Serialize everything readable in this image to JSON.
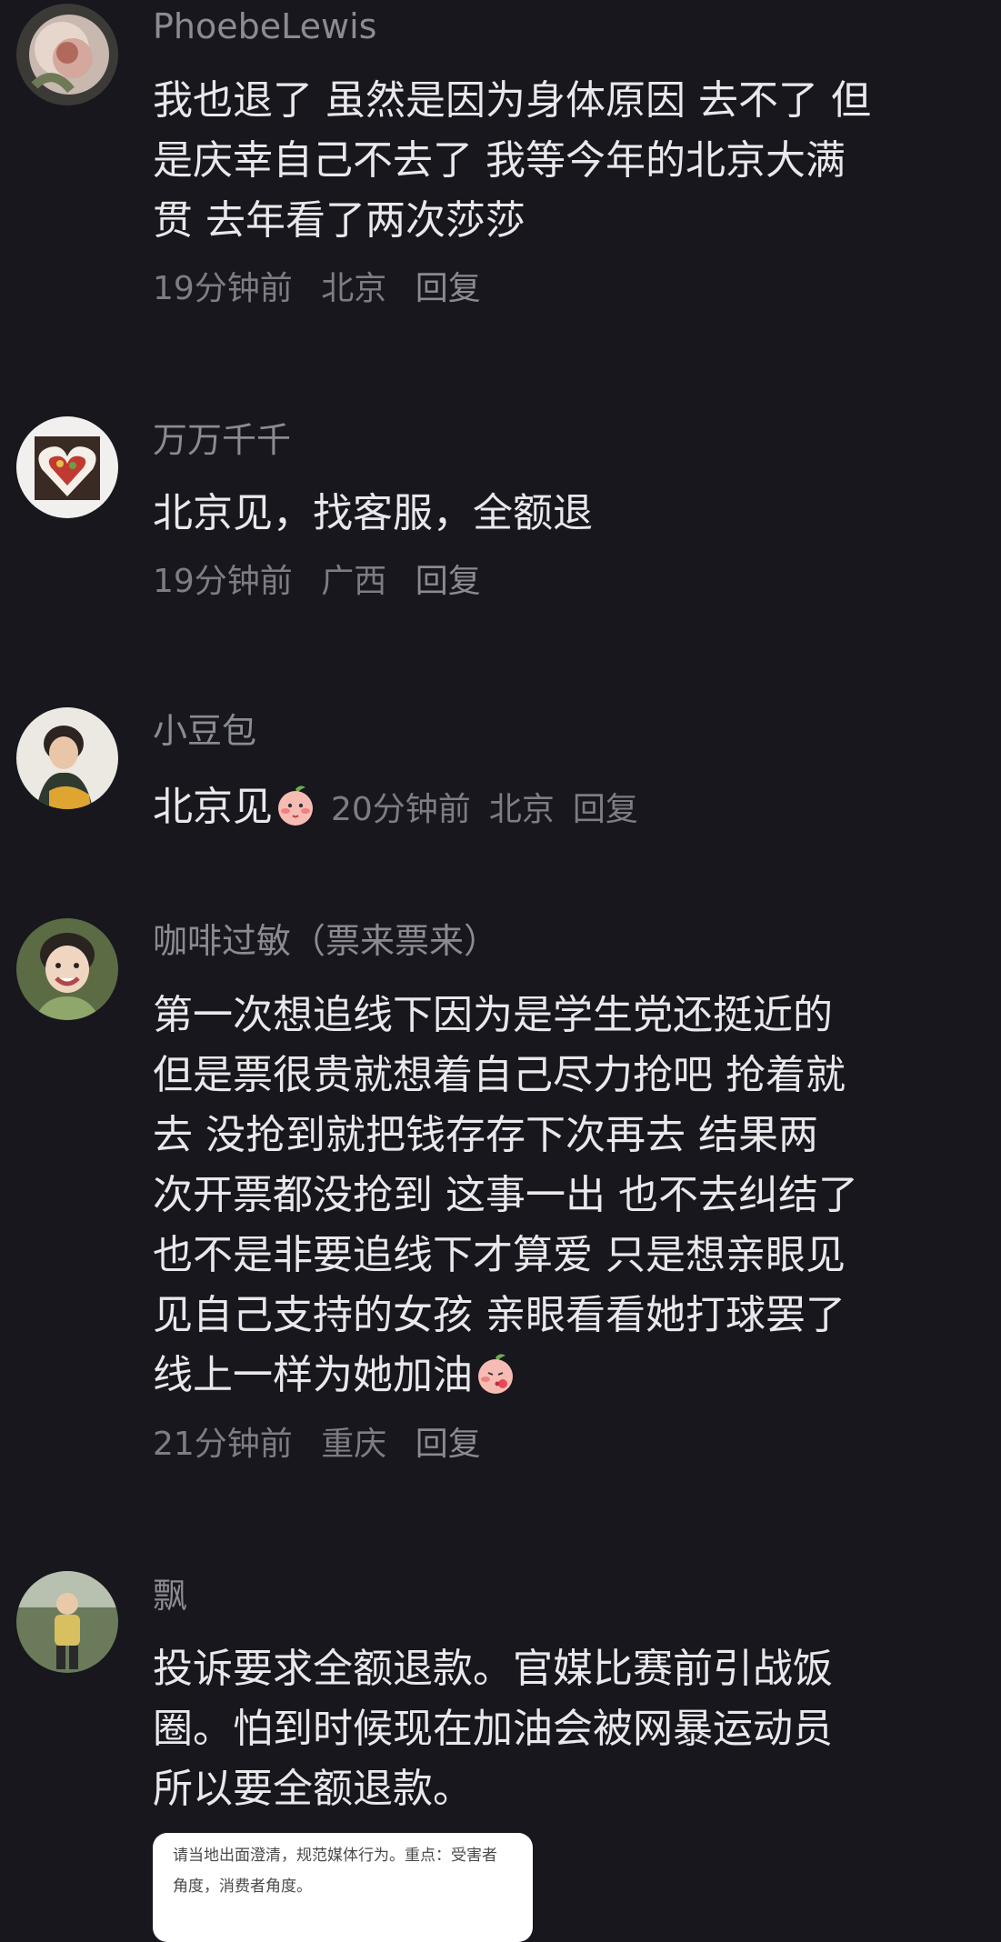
{
  "comments": [
    {
      "username": "PhoebeLewis",
      "lines": [
        "我也退了 虽然是因为身体原因 去不了 但",
        "是庆幸自己不去了 我等今年的北京大满",
        "贯 去年看了两次莎莎"
      ],
      "time": "19分钟前",
      "location": "北京",
      "reply_label": "回复",
      "avatar_icon": "peony-avatar"
    },
    {
      "username": "万万千千",
      "lines": [
        "北京见，找客服，全额退"
      ],
      "time": "19分钟前",
      "location": "广西",
      "reply_label": "回复",
      "avatar_icon": "heart-cake-avatar"
    },
    {
      "username": "小豆包",
      "lines": [
        "北京见"
      ],
      "time": "20分钟前",
      "location": "北京",
      "reply_label": "回复",
      "avatar_icon": "child-portrait-avatar",
      "emoji": "peach-blush-emoji"
    },
    {
      "username": "咖啡过敏（票来票来）",
      "lines": [
        "第一次想追线下因为是学生党还挺近的",
        "但是票很贵就想着自己尽力抢吧 抢着就",
        "去 没抢到就把钱存存下次再去   结果两",
        "次开票都没抢到 这事一出 也不去纠结了",
        "也不是非要追线下才算爱 只是想亲眼见",
        "见自己支持的女孩 亲眼看看她打球罢了",
        "线上一样为她加油"
      ],
      "time": "21分钟前",
      "location": "重庆",
      "reply_label": "回复",
      "avatar_icon": "smiling-girl-avatar",
      "emoji": "peach-kiss-emoji"
    },
    {
      "username": "飘",
      "lines": [
        "投诉要求全额退款。官媒比赛前引战饭",
        "圈。怕到时候现在加油会被网暴运动员",
        "所以要全额退款。"
      ],
      "avatar_icon": "person-outdoor-avatar"
    }
  ],
  "quote_card": {
    "lines": [
      "请当地出面澄清，规范媒体行为。重点：受害者",
      "角度，消费者角度。"
    ]
  },
  "colors": {
    "background": "#17171d",
    "text": "#e9e9ec",
    "muted": "#8b8b92"
  }
}
